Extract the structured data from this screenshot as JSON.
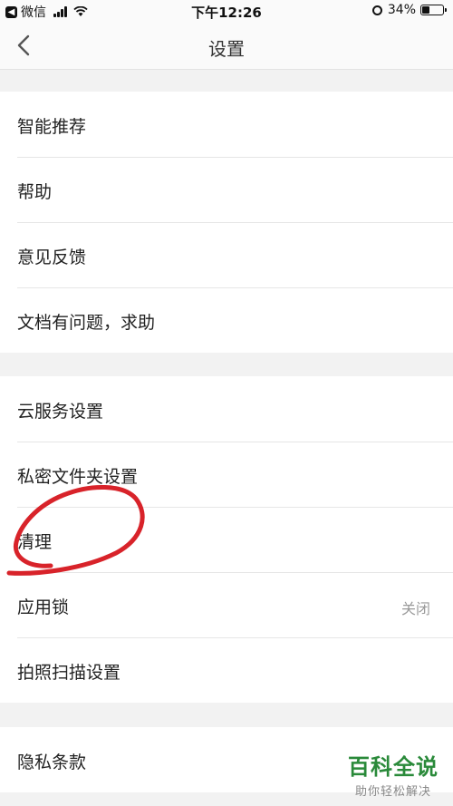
{
  "status_bar": {
    "back_app": "微信",
    "time": "下午12:26",
    "battery": "34%",
    "battery_level": 0.34
  },
  "nav": {
    "title": "设置"
  },
  "groups": [
    {
      "items": [
        {
          "label": "智能推荐"
        },
        {
          "label": "帮助"
        },
        {
          "label": "意见反馈"
        },
        {
          "label": "文档有问题，求助"
        }
      ]
    },
    {
      "items": [
        {
          "label": "云服务设置"
        },
        {
          "label": "私密文件夹设置"
        },
        {
          "label": "清理"
        },
        {
          "label": "应用锁",
          "value": "关闭"
        },
        {
          "label": "拍照扫描设置"
        }
      ]
    },
    {
      "items": [
        {
          "label": "隐私条款"
        }
      ]
    }
  ],
  "watermark": {
    "title": "百科全说",
    "subtitle": "助你轻松解决"
  },
  "colors": {
    "annotation": "#d8232a",
    "watermark": "#2a8a3a",
    "background": "#f2f2f2"
  }
}
